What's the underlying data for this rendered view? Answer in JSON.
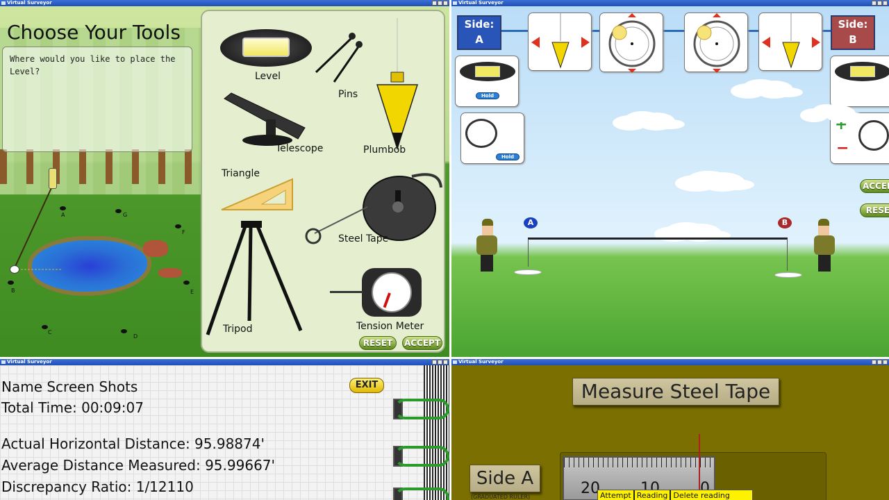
{
  "windows": {
    "tools": {
      "window_title": "Virtual Surveyor",
      "heading": "Choose Your Tools",
      "prompt": "Where would you like to place the Level?",
      "points": [
        "A",
        "G",
        "F",
        "B",
        "E",
        "C",
        "D"
      ],
      "tool_labels": {
        "level": "Level",
        "pins": "Pins",
        "telescope": "Telescope",
        "plumbob": "Plumbob",
        "triangle": "Triangle",
        "steel_tape": "Steel Tape",
        "tripod": "Tripod",
        "tension_meter": "Tension Meter"
      },
      "reset_label": "RESET",
      "accept_label": "ACCEPT"
    },
    "field": {
      "window_title": "Virtual Surveyor",
      "side_a": {
        "title": "Side:",
        "letter": "A"
      },
      "side_b": {
        "title": "Side:",
        "letter": "B"
      },
      "hold_label": "Hold",
      "accept_label": "ACCEPT",
      "reset_label": "RESET",
      "marker_a": "A",
      "marker_b": "B"
    },
    "results": {
      "window_title": "Virtual Surveyor",
      "exit_label": "EXIT",
      "name_line": "Name Screen Shots",
      "total_time": "Total Time: 00:09:07",
      "actual_distance": "Actual Horizontal Distance: 95.98874'",
      "average_distance": "Average Distance Measured: 95.99667'",
      "discrepancy": "Discrepancy Ratio: 1/12110"
    },
    "measure": {
      "window_title": "Virtual Surveyor",
      "heading": "Measure Steel Tape",
      "side_label": "Side A",
      "side_sublabel": "(GRADUATED RULER)",
      "ruler_ticks": [
        "20",
        "10",
        "0"
      ],
      "table_headers": [
        "Attempt",
        "Reading",
        "Delete reading"
      ]
    }
  },
  "colors": {
    "side_a": "#2a55b8",
    "side_b": "#a84a4a",
    "titlebar": "#2a5fc8",
    "button_green": "#5e8a1e"
  }
}
